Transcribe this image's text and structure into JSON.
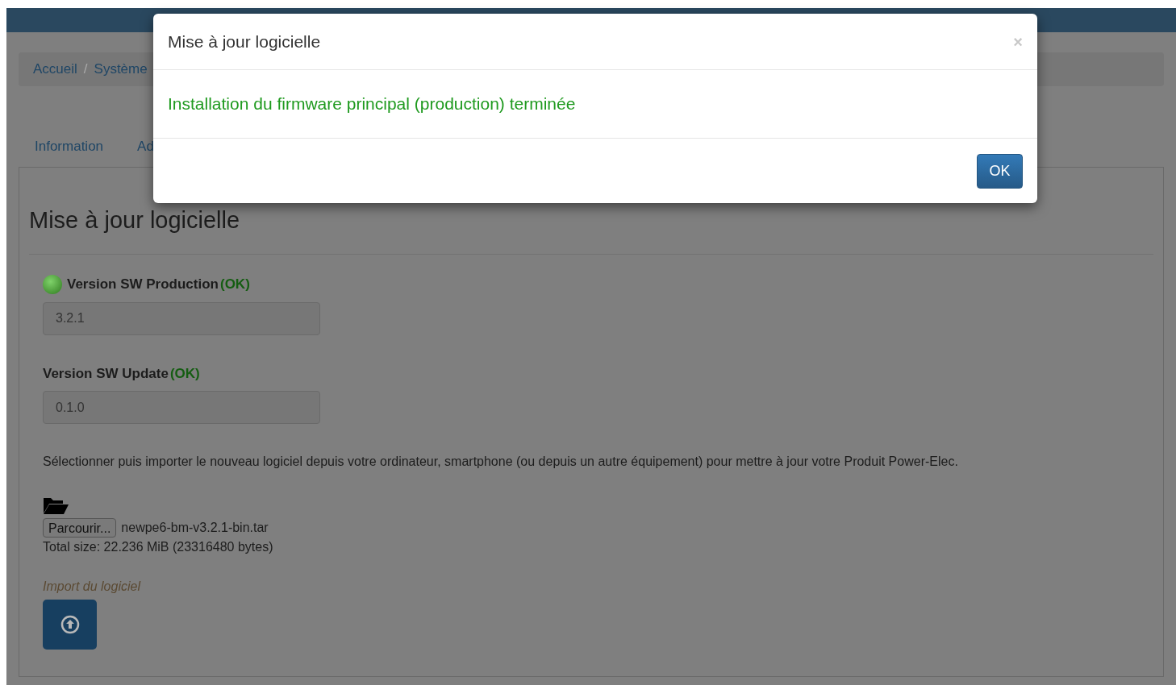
{
  "breadcrumb_separator": "/",
  "breadcrumb": [
    {
      "label": "Accueil"
    },
    {
      "label": "Système"
    }
  ],
  "tabs": [
    {
      "label": "Information",
      "selected": false
    },
    {
      "label": "Ad",
      "selected": false
    }
  ],
  "panel": {
    "title": "Mise à jour logicielle",
    "versions": [
      {
        "label": "Version SW Production",
        "status": "(OK)",
        "value": "3.2.1",
        "indicator": true
      },
      {
        "label": "Version SW Update",
        "status": "(OK)",
        "value": "0.1.0",
        "indicator": false
      }
    ],
    "instructions": "Sélectionner puis importer le nouveau logiciel depuis votre ordinateur, smartphone (ou depuis un autre équipement) pour mettre à jour votre Produit Power-Elec.",
    "browse_button": "Parcourir...",
    "file_name": "newpe6-bm-v3.2.1-bin.tar",
    "total_size": "Total size: 22.236 MiB (23316480 bytes)",
    "import_label": "Import du logiciel"
  },
  "modal": {
    "title": "Mise à jour logicielle",
    "close": "×",
    "message": "Installation du firmware principal (production) terminée",
    "button": "OK"
  }
}
